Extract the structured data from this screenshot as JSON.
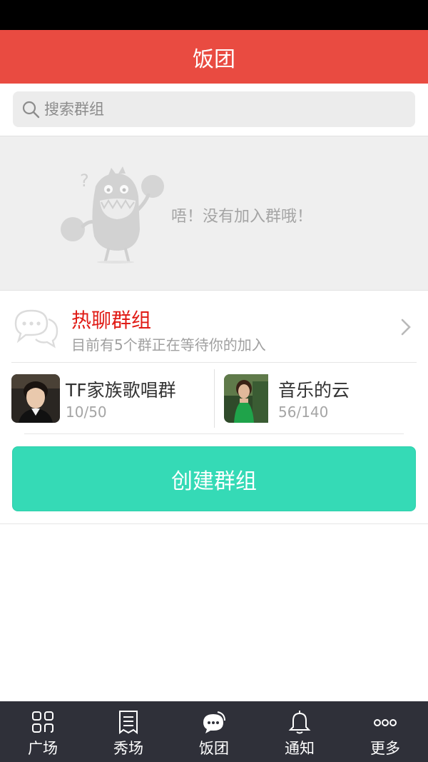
{
  "header": {
    "title": "饭团"
  },
  "search": {
    "placeholder": "搜索群组"
  },
  "empty_state": {
    "message": "唔！没有加入群哦！"
  },
  "hot_groups": {
    "title": "热聊群组",
    "subtitle": "目前有5个群正在等待你的加入"
  },
  "groups": [
    {
      "name": "TF家族歌唱群",
      "count": "10/50"
    },
    {
      "name": "音乐的云",
      "count": "56/140"
    }
  ],
  "create_button": {
    "label": "创建群组"
  },
  "nav": [
    {
      "label": "广场",
      "icon": "grid-icon"
    },
    {
      "label": "秀场",
      "icon": "document-icon"
    },
    {
      "label": "饭团",
      "icon": "chat-bubble-icon"
    },
    {
      "label": "通知",
      "icon": "bell-icon"
    },
    {
      "label": "更多",
      "icon": "more-icon"
    }
  ],
  "colors": {
    "header": "#e94b41",
    "accent_red": "#e01c16",
    "create_button": "#35dab6",
    "bottom_nav": "#2f3039"
  }
}
